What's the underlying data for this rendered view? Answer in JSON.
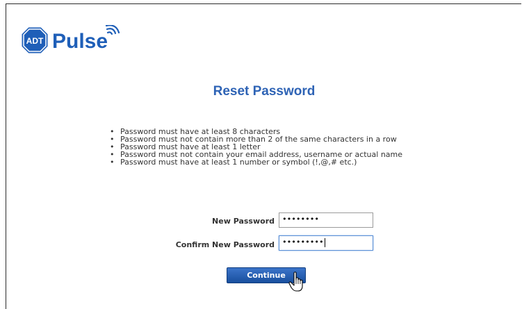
{
  "brand": {
    "badge_text": "ADT",
    "name": "Pulse",
    "badge_color": "#1f5fb8",
    "name_color": "#1f5fb8"
  },
  "title": "Reset Password",
  "rules": [
    "Password must have at least 8 characters",
    "Password must not contain more than 2 of the same characters in a row",
    "Password must have at least 1 letter",
    "Password must not contain your email address, username or actual name",
    "Password must have at least 1 number or symbol (!,@,# etc.)"
  ],
  "form": {
    "new_password_label": "New Password",
    "new_password_value": "••••••••",
    "confirm_password_label": "Confirm New Password",
    "confirm_password_value": "•••••••••"
  },
  "continue_label": "Continue",
  "icons": {
    "cursor": "hand-pointer-icon",
    "signal": "wireless-signal-icon"
  }
}
